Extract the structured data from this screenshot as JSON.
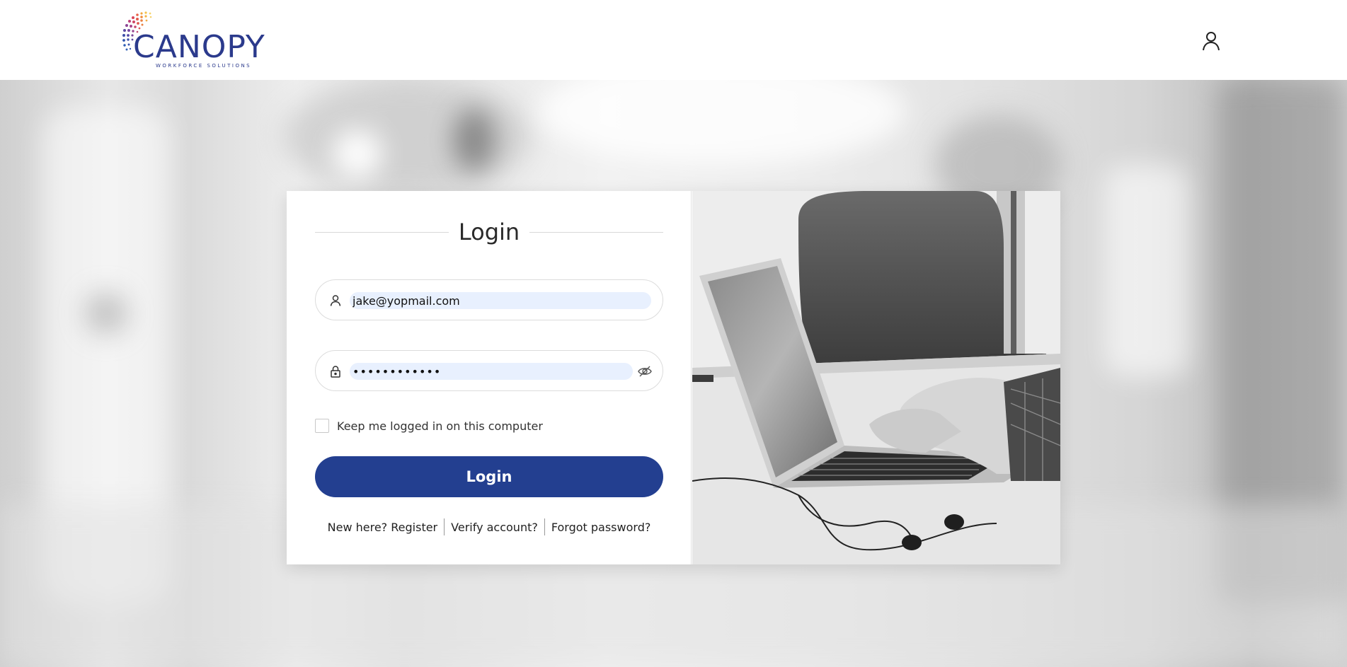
{
  "header": {
    "logo_text": "CANOPY",
    "logo_tagline": "WORKFORCE SOLUTIONS",
    "user_icon": "user-icon"
  },
  "login": {
    "title": "Login",
    "email_value": "jake@yopmail.com",
    "password_value": "••••••••••••",
    "keep_logged_label": "Keep me logged in on this computer",
    "keep_logged_checked": false,
    "submit_label": "Login",
    "links": {
      "register": "New here? Register",
      "verify": "Verify account?",
      "forgot": "Forgot password?"
    }
  },
  "colors": {
    "primary": "#233f90",
    "autofill_bg": "#e8f0fe",
    "logo": "#2b3a8c"
  },
  "icons": [
    "user-icon",
    "lock-icon",
    "eye-off-icon"
  ]
}
